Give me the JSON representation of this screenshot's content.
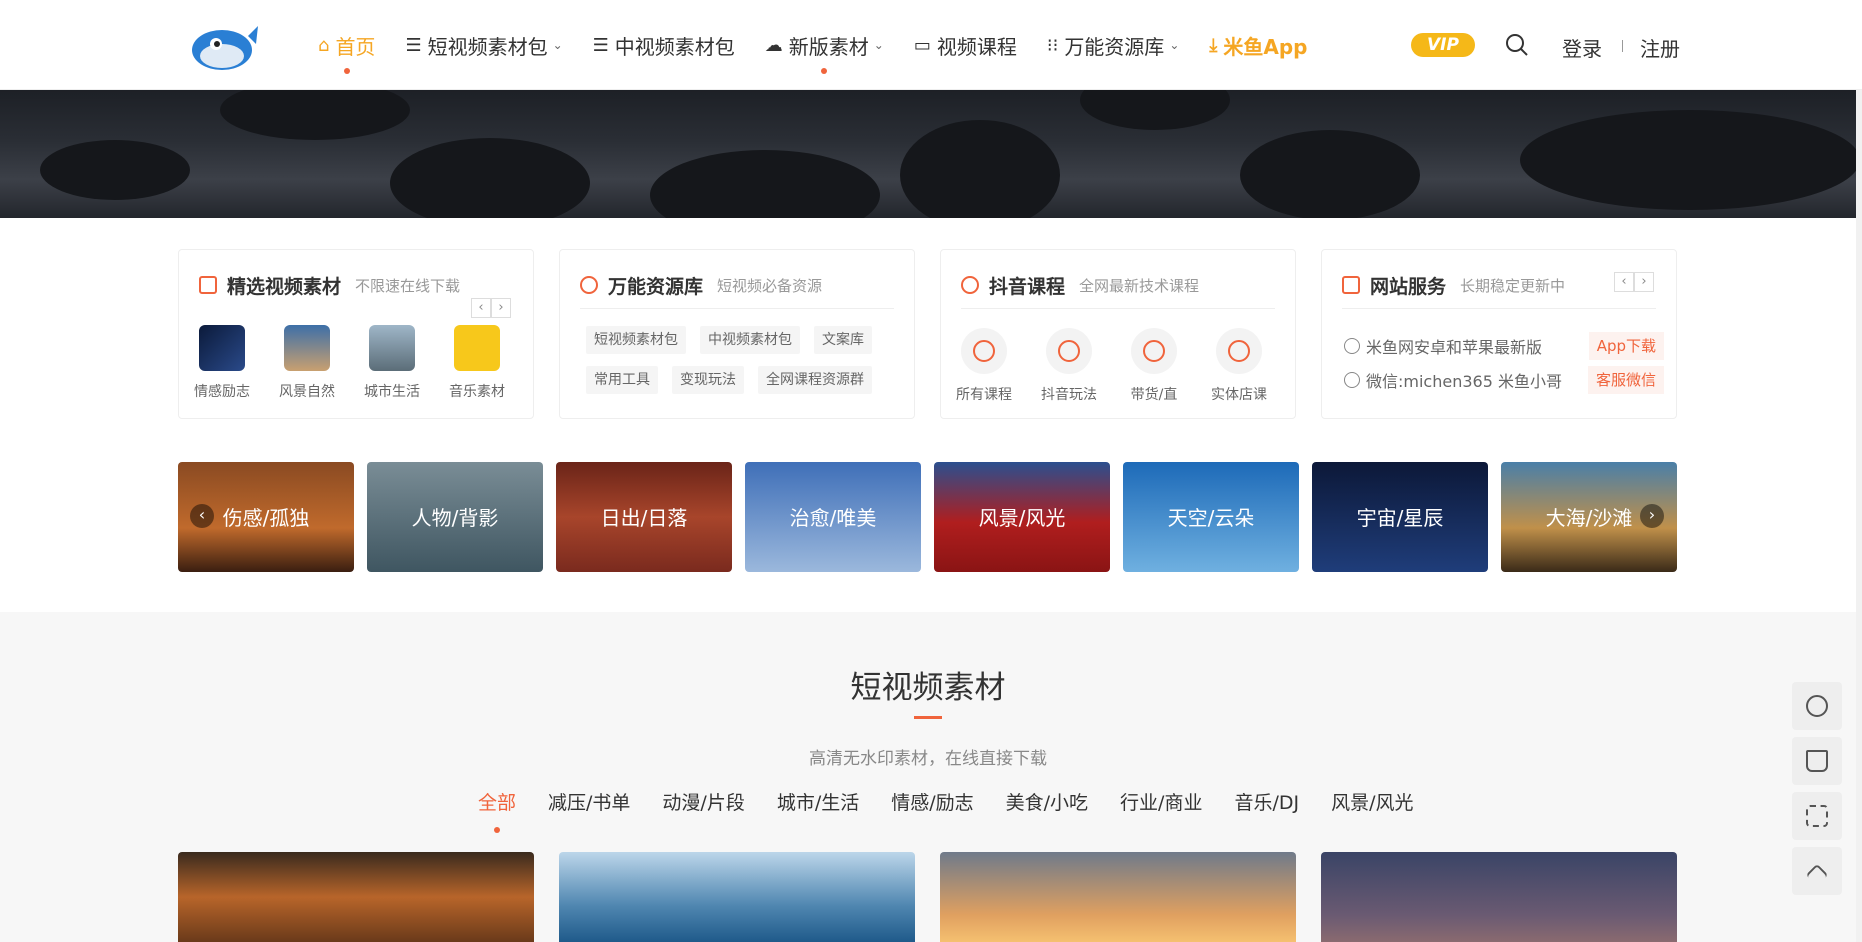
{
  "nav": {
    "items": [
      {
        "label": "首页",
        "icon": "home-icon"
      },
      {
        "label": "短视频素材包",
        "icon": "list-icon"
      },
      {
        "label": "中视频素材包",
        "icon": "list-icon"
      },
      {
        "label": "新版素材",
        "icon": "cloud-download-icon"
      },
      {
        "label": "视频课程",
        "icon": "video-icon"
      },
      {
        "label": "万能资源库",
        "icon": "grid-icon"
      },
      {
        "label": "米鱼App",
        "icon": "download-icon"
      }
    ],
    "vip": "VIP",
    "login": "登录",
    "register": "注册"
  },
  "cards": {
    "featured": {
      "title": "精选视频素材",
      "subtitle": "不限速在线下载",
      "items": [
        "情感励志",
        "风景自然",
        "城市生活",
        "音乐素材"
      ]
    },
    "resources": {
      "title": "万能资源库",
      "subtitle": "短视频必备资源",
      "tags": [
        "短视频素材包",
        "中视频素材包",
        "文案库",
        "常用工具",
        "变现玩法",
        "全网课程资源群"
      ]
    },
    "douyin": {
      "title": "抖音课程",
      "subtitle": "全网最新技术课程",
      "items": [
        "所有课程",
        "抖音玩法",
        "带货/直",
        "实体店课"
      ]
    },
    "service": {
      "title": "网站服务",
      "subtitle": "长期稳定更新中",
      "rows": [
        {
          "text": "米鱼网安卓和苹果最新版",
          "button": "App下载"
        },
        {
          "text": "微信:michen365 米鱼小哥",
          "button": "客服微信"
        }
      ]
    }
  },
  "categories": [
    "伤感/孤独",
    "人物/背影",
    "日出/日落",
    "治愈/唯美",
    "风景/风光",
    "天空/云朵",
    "宇宙/星辰",
    "大海/沙滩"
  ],
  "section": {
    "title": "短视频素材",
    "subtitle": "高清无水印素材，在线直接下载",
    "tabs": [
      "全部",
      "减压/书单",
      "动漫/片段",
      "城市/生活",
      "情感/励志",
      "美食/小吃",
      "行业/商业",
      "音乐/DJ",
      "风景/风光"
    ]
  },
  "colors": {
    "accent": "#f0643c",
    "nav_active": "#f5a623",
    "vip": "#f5b818"
  }
}
